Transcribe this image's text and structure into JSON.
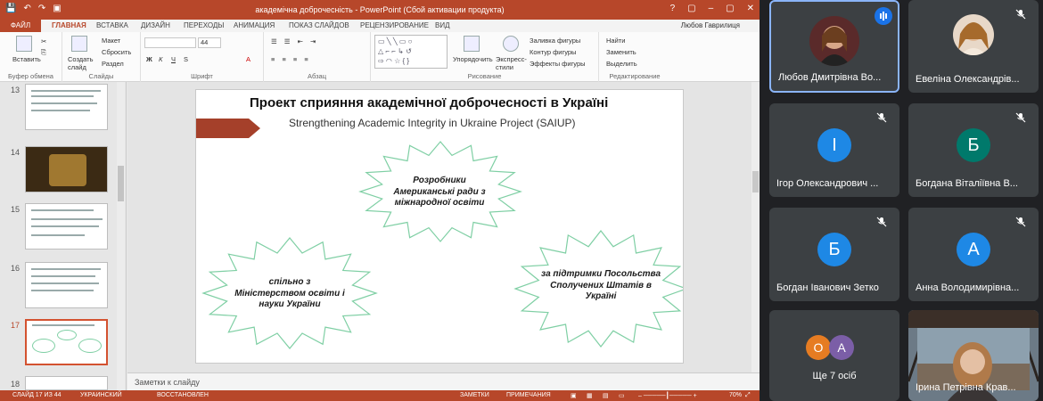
{
  "ppt": {
    "window_title": "академічна доброчесність - PowerPoint (Сбой активации продукта)",
    "window_buttons": [
      "?",
      "▢",
      "–",
      "▢",
      "✕"
    ],
    "tabs": [
      "ФАЙЛ",
      "ГЛАВНАЯ",
      "ВСТАВКА",
      "ДИЗАЙН",
      "ПЕРЕХОДЫ",
      "АНИМАЦИЯ",
      "ПОКАЗ СЛАЙДОВ",
      "РЕЦЕНЗИРОВАНИЕ",
      "ВИД"
    ],
    "active_tab": "ГЛАВНАЯ",
    "user": "Любов Гаврилиця",
    "ribbon": {
      "paste": "Вставить",
      "create_slide": "Создать слайд",
      "layout": "Макет",
      "reset": "Сбросить",
      "section": "Раздел",
      "font_size": "44",
      "bold": "Ж",
      "italic": "К",
      "underline": "Ч",
      "strike": "S",
      "font_color": "А",
      "arrange": "Упорядочить",
      "quick_styles": "Экспресс-стили",
      "shape_fill": "Заливка фигуры",
      "shape_outline": "Контур фигуры",
      "shape_effects": "Эффекты фигуры",
      "find": "Найти",
      "replace": "Заменить",
      "select": "Выделить",
      "group_clipboard": "Буфер обмена",
      "group_slides": "Слайды",
      "group_font": "Шрифт",
      "group_paragraph": "Абзац",
      "group_drawing": "Рисование",
      "group_editing": "Редактирование"
    },
    "thumbnails": [
      {
        "num": "13"
      },
      {
        "num": "14"
      },
      {
        "num": "15"
      },
      {
        "num": "16"
      },
      {
        "num": "17",
        "selected": true
      },
      {
        "num": "18"
      }
    ],
    "slide": {
      "title": "Проект сприяння академічної доброчесності в Україні",
      "subtitle": "Strengthening Academic Integrity in Ukraine Project (SAIUP)",
      "star1": "Розробники Американські ради з міжнародної освіти",
      "star1_line1": "Розробники",
      "star1_line2": "Американські ради з",
      "star1_line3": "міжнародної освіти",
      "star2_line1": "спільно з",
      "star2_line2": "Міністерством освіти і",
      "star2_line3": "науки України",
      "star3_line1": "за підтримки Посольства",
      "star3_line2": "Сполучених Штатів в",
      "star3_line3": "Україні"
    },
    "notes_placeholder": "Заметки к слайду",
    "status": {
      "slide_info": "СЛАЙД 17 ИЗ 44",
      "language": "УКРАИНСКИЙ",
      "recovered": "ВОССТАНОВЛЕН",
      "notes": "ЗАМЕТКИ",
      "comments": "ПРИМЕЧАНИЯ",
      "zoom": "70%"
    },
    "colors": {
      "accent": "#b7472a",
      "arrow": "#a5402a",
      "star_outline": "#7fcfa4"
    }
  },
  "meet": {
    "participants": [
      {
        "name": "Любов Дмитрівна Во...",
        "kind": "photo",
        "speaking": true
      },
      {
        "name": "Евеліна Олександрів...",
        "kind": "photo",
        "muted": true
      },
      {
        "name": "Ігор Олександрович ...",
        "initial": "І",
        "color": "#1e88e5",
        "muted": true
      },
      {
        "name": "Богдана Віталіївна В...",
        "initial": "Б",
        "color": "#00796b",
        "muted": true
      },
      {
        "name": "Богдан Іванович Зетко",
        "initial": "Б",
        "color": "#1e88e5",
        "muted": true
      },
      {
        "name": "Анна Володимирівна...",
        "initial": "А",
        "color": "#1e88e5",
        "muted": true
      },
      {
        "name": "Ще 7 осіб",
        "kind": "more",
        "initials": [
          "О",
          "А"
        ],
        "colors": [
          "#e67c22",
          "#7b5ea7"
        ]
      },
      {
        "name": "Ірина Петрівна Крав...",
        "kind": "video"
      }
    ]
  }
}
